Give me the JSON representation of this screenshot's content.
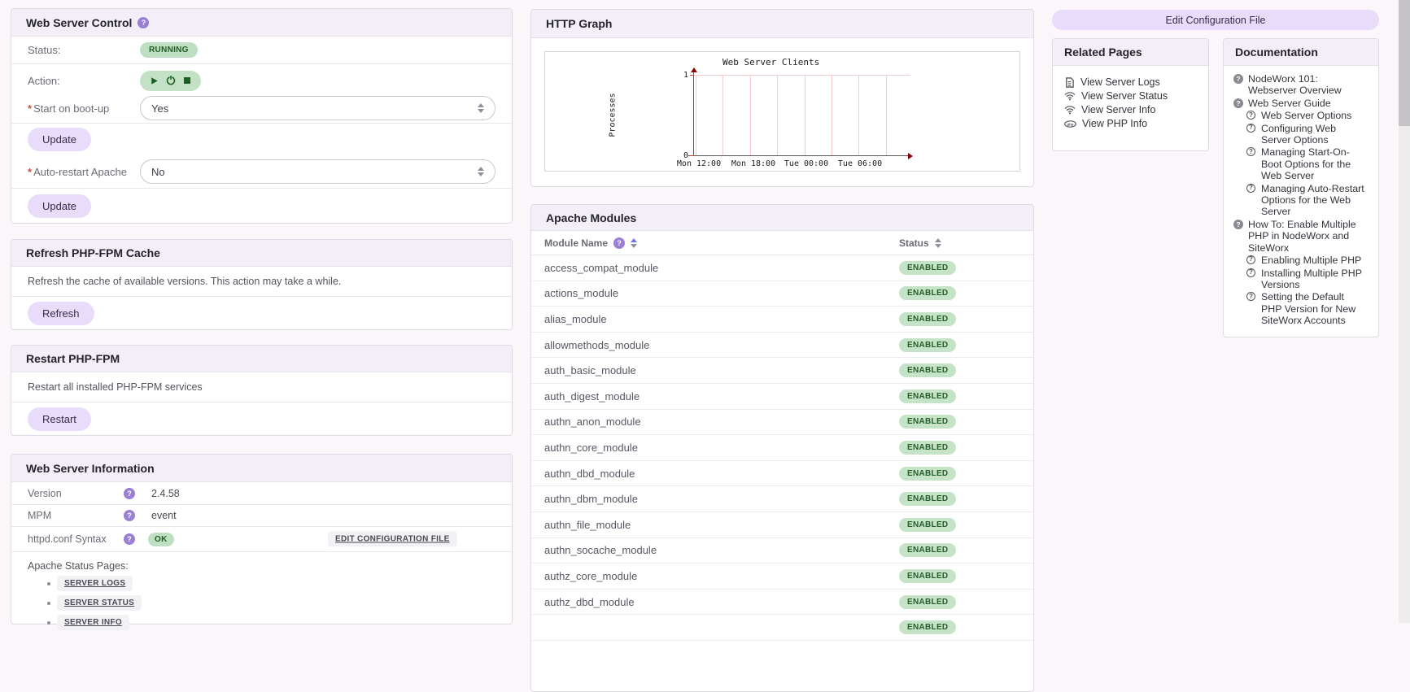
{
  "colors": {
    "accent_purple": "#e9dcfa",
    "header_lavender": "#f3eef7",
    "badge_green_bg": "#bedfc1",
    "badge_green_text": "#1e5b25",
    "help_icon_purple": "#9b7fd4",
    "graph_dark_red": "#8b0000",
    "graph_grid_pink": "#f6caca"
  },
  "web_server_control": {
    "title": "Web Server Control",
    "required_marker": "*",
    "status_label": "Status:",
    "status_value": "RUNNING",
    "action_label": "Action:",
    "boot_label": "Start on boot-up",
    "boot_value": "Yes",
    "update_label": "Update",
    "autorestart_label": "Auto-restart Apache",
    "autorestart_value": "No",
    "update2_label": "Update"
  },
  "refresh_cache": {
    "title": "Refresh PHP-FPM Cache",
    "description": "Refresh the cache of available versions. This action may take a while.",
    "button": "Refresh"
  },
  "restart_fpm": {
    "title": "Restart PHP-FPM",
    "description": "Restart all installed PHP-FPM services",
    "button": "Restart"
  },
  "server_info": {
    "title": "Web Server Information",
    "version_label": "Version",
    "version_value": "2.4.58",
    "mpm_label": "MPM",
    "mpm_value": "event",
    "syntax_label": "httpd.conf Syntax",
    "syntax_value": "OK",
    "edit_config_link": "EDIT CONFIGURATION FILE",
    "status_pages_label": "Apache Status Pages:",
    "status_pages": [
      "SERVER LOGS",
      "SERVER STATUS",
      "SERVER INFO"
    ]
  },
  "http_graph": {
    "title": "HTTP Graph",
    "chart_data": {
      "type": "line",
      "title": "Web Server Clients",
      "ylabel": "Processes",
      "ylim": [
        0,
        1
      ],
      "yticks": [
        "1",
        "0"
      ],
      "xticks": [
        "Mon 12:00",
        "Mon 18:00",
        "Tue 00:00",
        "Tue 06:00"
      ],
      "series": [],
      "note_gridlines": 8
    }
  },
  "apache_modules": {
    "title": "Apache Modules",
    "col_module": "Module Name",
    "col_status": "Status",
    "status_value": "ENABLED",
    "modules": [
      "access_compat_module",
      "actions_module",
      "alias_module",
      "allowmethods_module",
      "auth_basic_module",
      "auth_digest_module",
      "authn_anon_module",
      "authn_core_module",
      "authn_dbd_module",
      "authn_dbm_module",
      "authn_file_module",
      "authn_socache_module",
      "authz_core_module",
      "authz_dbd_module"
    ],
    "partial_row_status": "ENABLED"
  },
  "toolbar": {
    "edit_config_button": "Edit Configuration File"
  },
  "related_pages": {
    "title": "Related Pages",
    "links": [
      {
        "icon": "file-icon",
        "label": "View Server Logs"
      },
      {
        "icon": "wifi-icon",
        "label": "View Server Status"
      },
      {
        "icon": "wifi-icon",
        "label": "View Server Info"
      },
      {
        "icon": "php-icon",
        "label": "View PHP Info"
      }
    ]
  },
  "documentation": {
    "title": "Documentation",
    "items": [
      {
        "level": 1,
        "label": "NodeWorx 101: Webserver Overview"
      },
      {
        "level": 1,
        "label": "Web Server Guide"
      },
      {
        "level": 2,
        "label": "Web Server Options"
      },
      {
        "level": 2,
        "label": "Configuring Web Server Options"
      },
      {
        "level": 2,
        "label": "Managing Start-On-Boot Options for the Web Server"
      },
      {
        "level": 2,
        "label": "Managing Auto-Restart Options for the Web Server"
      },
      {
        "level": 1,
        "label": "How To: Enable Multiple PHP in NodeWorx and SiteWorx"
      },
      {
        "level": 2,
        "label": "Enabling Multiple PHP"
      },
      {
        "level": 2,
        "label": "Installing Multiple PHP Versions"
      },
      {
        "level": 2,
        "label": "Setting the Default PHP Version for New SiteWorx Accounts"
      }
    ]
  }
}
